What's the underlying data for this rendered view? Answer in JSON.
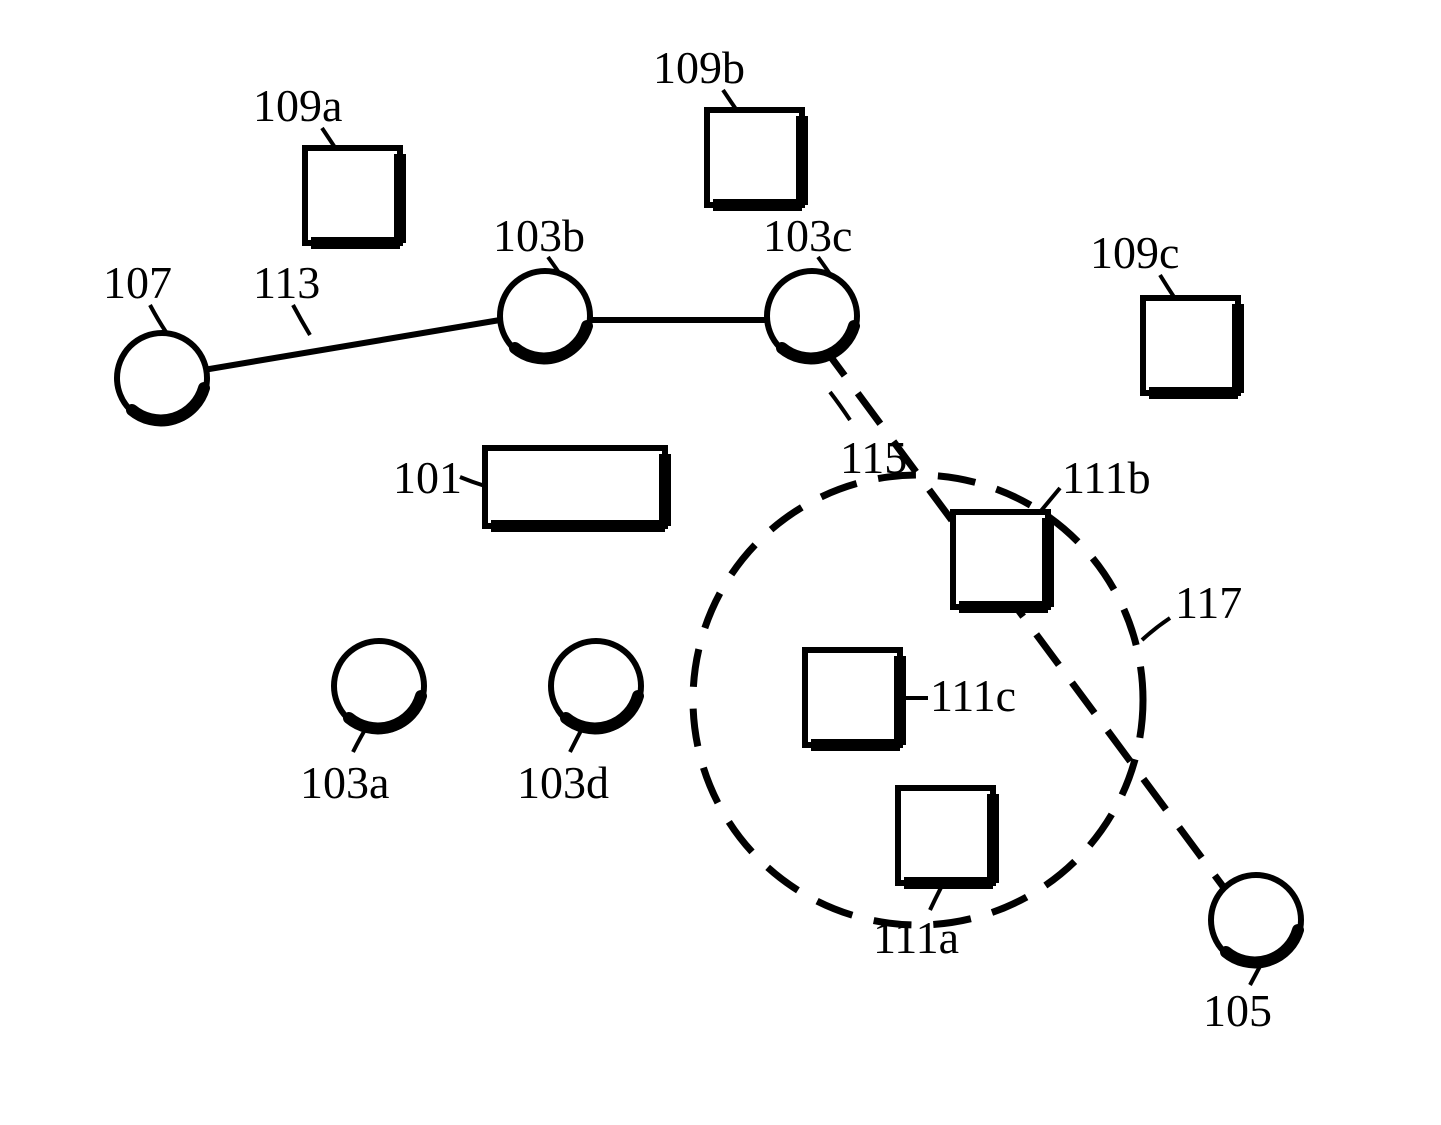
{
  "labels": {
    "n109a": "109a",
    "n109b": "109b",
    "n109c": "109c",
    "n107": "107",
    "n113": "113",
    "n103b": "103b",
    "n103c": "103c",
    "n101": "101",
    "n115": "115",
    "n111b": "111b",
    "n117": "117",
    "n103a": "103a",
    "n103d": "103d",
    "n111c": "111c",
    "n111a": "111a",
    "n105": "105"
  }
}
